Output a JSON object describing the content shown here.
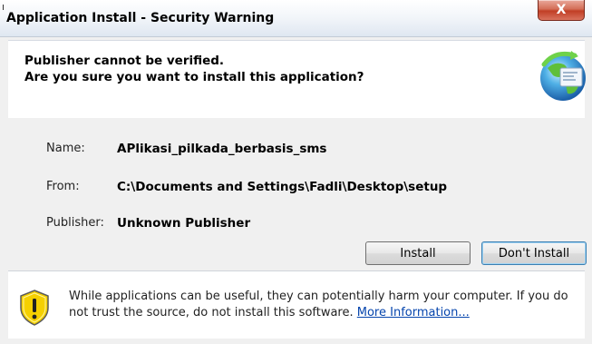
{
  "window": {
    "title": "Application Install - Security Warning",
    "close_label": "X"
  },
  "header": {
    "line1": "Publisher cannot be verified.",
    "line2": "Are you sure you want to install this application?",
    "icon": "application-globe-icon"
  },
  "details": {
    "name_label": "Name:",
    "name_value": "APlikasi_pilkada_berbasis_sms",
    "from_label": "From:",
    "from_value": "C:\\Documents and Settings\\Fadli\\Desktop\\setup",
    "publisher_label": "Publisher:",
    "publisher_value": "Unknown Publisher"
  },
  "buttons": {
    "install_label": "Install",
    "dont_install_label": "Don't Install"
  },
  "footer": {
    "warning_text": "While applications can be useful, they can potentially harm your computer. If you do not trust the source, do not install this software.",
    "link_text": "More Information...",
    "icon": "shield-warning-icon"
  },
  "colors": {
    "link": "#0645ad",
    "close_button": "#c13e25",
    "shield_yellow": "#f5d000"
  }
}
